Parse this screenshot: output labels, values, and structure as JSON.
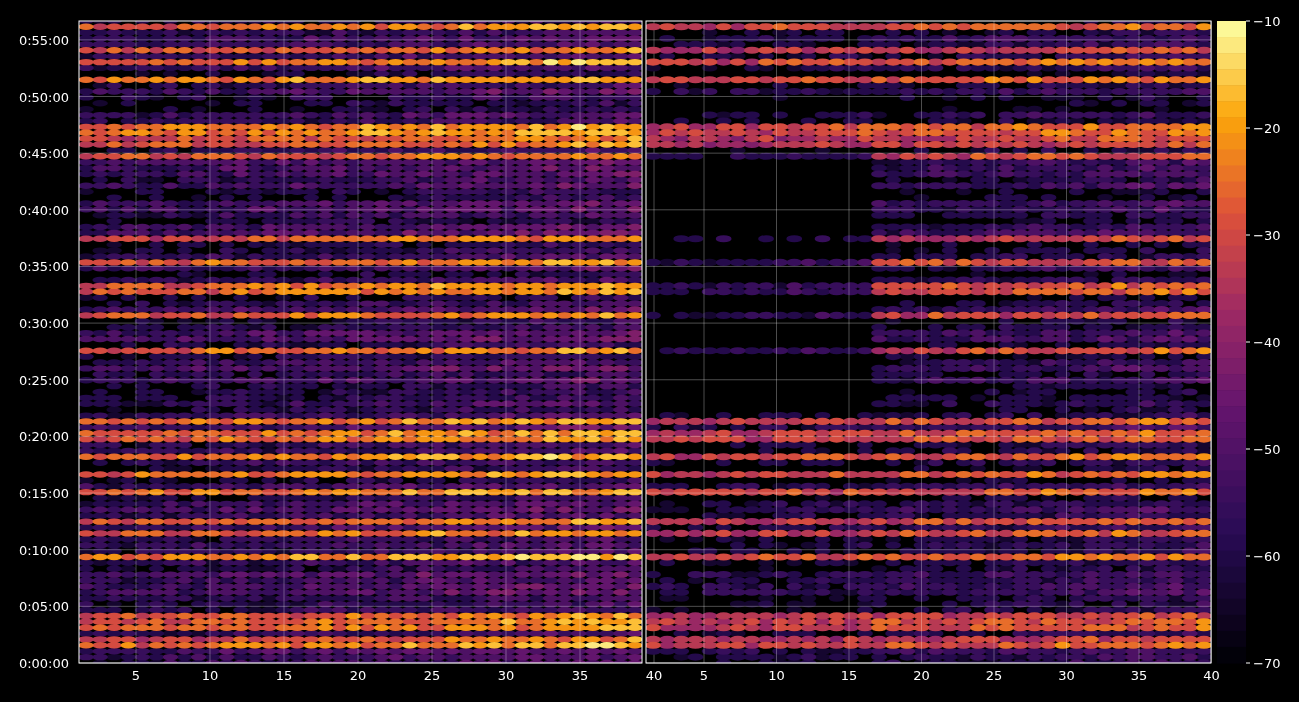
{
  "y_axis": {
    "ticks": [
      "0:55:00",
      "0:50:00",
      "0:45:00",
      "0:40:00",
      "0:35:00",
      "0:30:00",
      "0:25:00",
      "0:20:00",
      "0:15:00",
      "0:10:00",
      "0:05:00",
      "0:00:00"
    ]
  },
  "panels": [
    {
      "x_ticks": [
        "5",
        "10",
        "15",
        "20",
        "25",
        "30",
        "35",
        "40"
      ]
    },
    {
      "x_ticks": [
        "5",
        "10",
        "15",
        "20",
        "25",
        "30",
        "35",
        "40"
      ]
    }
  ],
  "colorbar": {
    "ticks": [
      "−10",
      "−20",
      "−30",
      "−40",
      "−50",
      "−60",
      "−70"
    ]
  }
}
